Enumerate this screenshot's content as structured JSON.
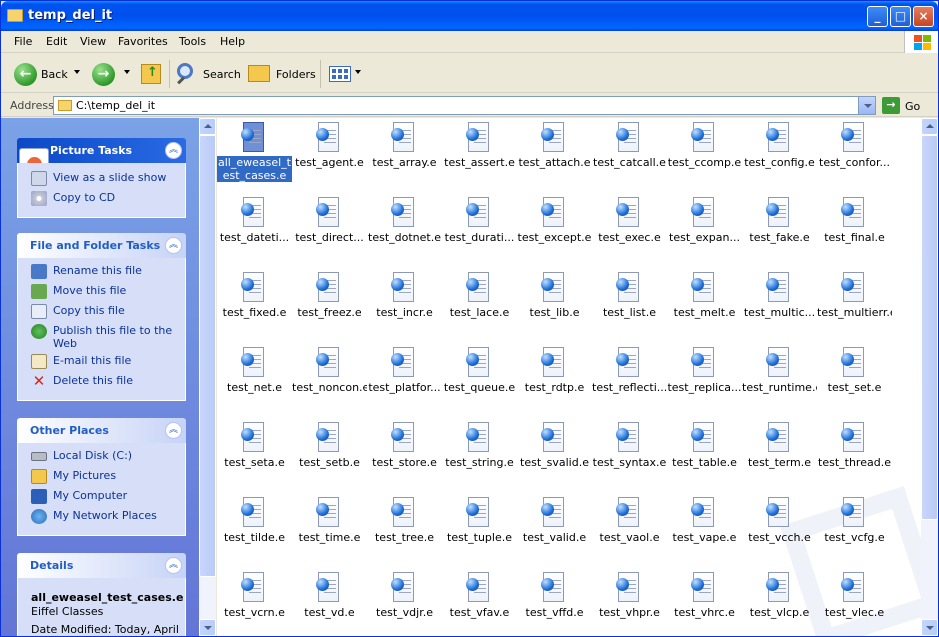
{
  "window": {
    "title": "temp_del_it",
    "minimize": "_",
    "maximize": "□",
    "close": "×"
  },
  "menu": [
    "File",
    "Edit",
    "View",
    "Favorites",
    "Tools",
    "Help"
  ],
  "toolbar": {
    "back_label": "Back",
    "search_label": "Search",
    "folders_label": "Folders"
  },
  "address": {
    "label": "Address",
    "value": "C:\\temp_del_it",
    "go_label": "Go"
  },
  "sidebar": {
    "picture_tasks": {
      "title": "Picture Tasks",
      "items": [
        "View as a slide show",
        "Copy to CD"
      ]
    },
    "file_folder_tasks": {
      "title": "File and Folder Tasks",
      "items": [
        "Rename this file",
        "Move this file",
        "Copy this file",
        "Publish this file to the Web",
        "E-mail this file",
        "Delete this file"
      ]
    },
    "other_places": {
      "title": "Other Places",
      "items": [
        "Local Disk (C:)",
        "My Pictures",
        "My Computer",
        "My Network Places"
      ]
    },
    "details": {
      "title": "Details",
      "name": "all_eweasel_test_cases.e",
      "type": "Eiffel Classes",
      "modified": "Date Modified: Today, April"
    }
  },
  "files": [
    {
      "label": "all_eweasel_test_cases.e",
      "selected": true
    },
    {
      "label": "test_agent.e"
    },
    {
      "label": "test_array.e"
    },
    {
      "label": "test_assert.e"
    },
    {
      "label": "test_attach.e"
    },
    {
      "label": "test_catcall.e"
    },
    {
      "label": "test_ccomp.e"
    },
    {
      "label": "test_config.e"
    },
    {
      "label": "test_confor..."
    },
    {
      "label": "test_dateti..."
    },
    {
      "label": "test_direct..."
    },
    {
      "label": "test_dotnet.e"
    },
    {
      "label": "test_durati..."
    },
    {
      "label": "test_except.e"
    },
    {
      "label": "test_exec.e"
    },
    {
      "label": "test_expan..."
    },
    {
      "label": "test_fake.e"
    },
    {
      "label": "test_final.e"
    },
    {
      "label": "test_fixed.e"
    },
    {
      "label": "test_freez.e"
    },
    {
      "label": "test_incr.e"
    },
    {
      "label": "test_lace.e"
    },
    {
      "label": "test_lib.e"
    },
    {
      "label": "test_list.e"
    },
    {
      "label": "test_melt.e"
    },
    {
      "label": "test_multic..."
    },
    {
      "label": "test_multierr.e"
    },
    {
      "label": "test_net.e"
    },
    {
      "label": "test_noncon.e"
    },
    {
      "label": "test_platfor..."
    },
    {
      "label": "test_queue.e"
    },
    {
      "label": "test_rdtp.e"
    },
    {
      "label": "test_reflecti..."
    },
    {
      "label": "test_replica..."
    },
    {
      "label": "test_runtime.e"
    },
    {
      "label": "test_set.e"
    },
    {
      "label": "test_seta.e"
    },
    {
      "label": "test_setb.e"
    },
    {
      "label": "test_store.e"
    },
    {
      "label": "test_string.e"
    },
    {
      "label": "test_svalid.e"
    },
    {
      "label": "test_syntax.e"
    },
    {
      "label": "test_table.e"
    },
    {
      "label": "test_term.e"
    },
    {
      "label": "test_thread.e"
    },
    {
      "label": "test_tilde.e"
    },
    {
      "label": "test_time.e"
    },
    {
      "label": "test_tree.e"
    },
    {
      "label": "test_tuple.e"
    },
    {
      "label": "test_valid.e"
    },
    {
      "label": "test_vaol.e"
    },
    {
      "label": "test_vape.e"
    },
    {
      "label": "test_vcch.e"
    },
    {
      "label": "test_vcfg.e"
    },
    {
      "label": "test_vcrn.e"
    },
    {
      "label": "test_vd.e"
    },
    {
      "label": "test_vdjr.e"
    },
    {
      "label": "test_vfav.e"
    },
    {
      "label": "test_vffd.e"
    },
    {
      "label": "test_vhpr.e"
    },
    {
      "label": "test_vhrc.e"
    },
    {
      "label": "test_vlcp.e"
    },
    {
      "label": "test_vlec.e"
    }
  ],
  "colors": {
    "titlebar": "#0053ee",
    "sidebar": "#6b8ee0",
    "selection": "#316ac5",
    "link": "#0c3299"
  }
}
